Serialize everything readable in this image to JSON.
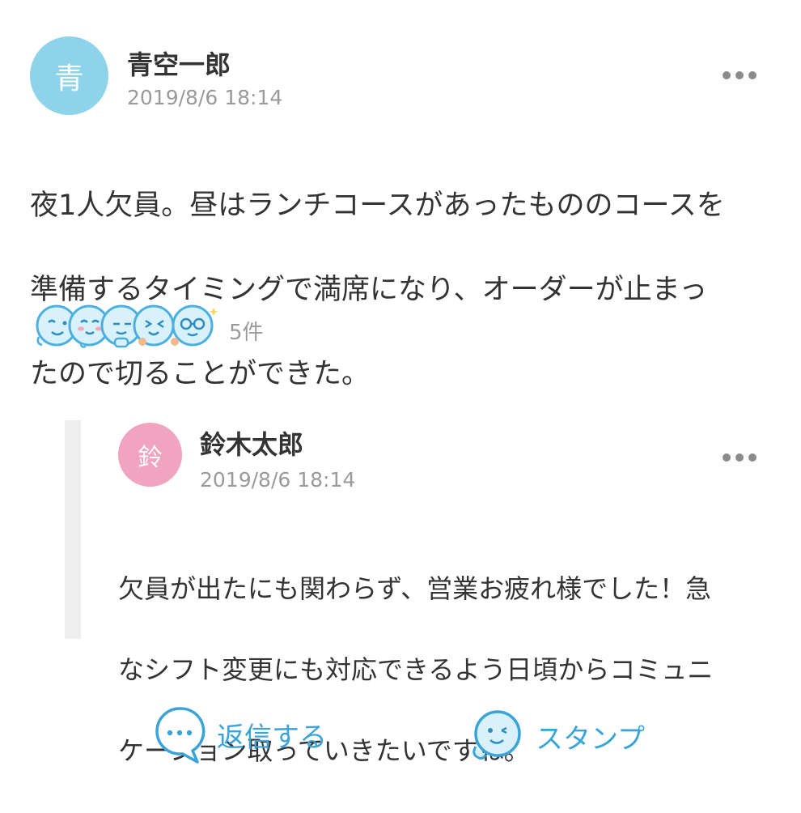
{
  "post": {
    "avatar_char": "青",
    "avatar_color": "#8ed3ea",
    "author": "青空一郎",
    "timestamp": "2019/8/6 18:14",
    "more_icon": "more-dots-icon",
    "lines": [
      "夜1人欠員。昼はランチコースがあったもののコースを",
      "準備するタイミングで満席になり、オーダーが止まっ",
      "たので切ることができた。"
    ],
    "stamp_count": "5件"
  },
  "reply": {
    "avatar_char": "鈴",
    "avatar_color": "#f0a4c0",
    "author": "鈴木太郎",
    "timestamp": "2019/8/6 18:14",
    "lines": [
      "欠員が出たにも関わらず、営業お疲れ様でした！急",
      "なシフト変更にも対応できるよう日頃からコミュニ",
      "ケーション取っていきたいですね。"
    ]
  },
  "actions": {
    "reply_label": "返信する",
    "reply_icon": "speech-bubble-icon",
    "stamp_label": "スタンプ",
    "stamp_icon": "smiley-face-icon"
  },
  "colors": {
    "accent": "#3aa3d8",
    "stamp_fill": "#d9f1fb",
    "stamp_stroke": "#4ab0e2"
  }
}
